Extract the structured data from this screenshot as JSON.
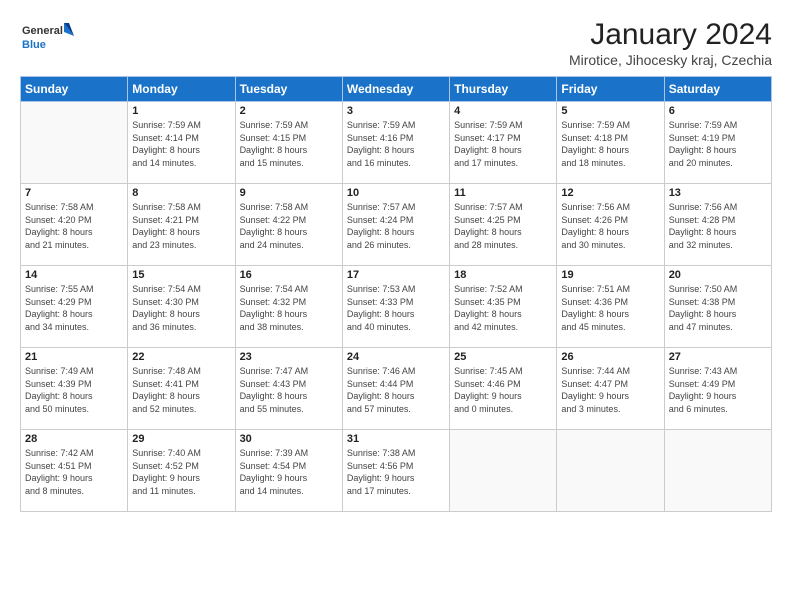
{
  "logo": {
    "line1": "General",
    "line2": "Blue"
  },
  "title": "January 2024",
  "subtitle": "Mirotice, Jihocesky kraj, Czechia",
  "header_days": [
    "Sunday",
    "Monday",
    "Tuesday",
    "Wednesday",
    "Thursday",
    "Friday",
    "Saturday"
  ],
  "weeks": [
    [
      {
        "day": "",
        "info": ""
      },
      {
        "day": "1",
        "info": "Sunrise: 7:59 AM\nSunset: 4:14 PM\nDaylight: 8 hours\nand 14 minutes."
      },
      {
        "day": "2",
        "info": "Sunrise: 7:59 AM\nSunset: 4:15 PM\nDaylight: 8 hours\nand 15 minutes."
      },
      {
        "day": "3",
        "info": "Sunrise: 7:59 AM\nSunset: 4:16 PM\nDaylight: 8 hours\nand 16 minutes."
      },
      {
        "day": "4",
        "info": "Sunrise: 7:59 AM\nSunset: 4:17 PM\nDaylight: 8 hours\nand 17 minutes."
      },
      {
        "day": "5",
        "info": "Sunrise: 7:59 AM\nSunset: 4:18 PM\nDaylight: 8 hours\nand 18 minutes."
      },
      {
        "day": "6",
        "info": "Sunrise: 7:59 AM\nSunset: 4:19 PM\nDaylight: 8 hours\nand 20 minutes."
      }
    ],
    [
      {
        "day": "7",
        "info": "Sunrise: 7:58 AM\nSunset: 4:20 PM\nDaylight: 8 hours\nand 21 minutes."
      },
      {
        "day": "8",
        "info": "Sunrise: 7:58 AM\nSunset: 4:21 PM\nDaylight: 8 hours\nand 23 minutes."
      },
      {
        "day": "9",
        "info": "Sunrise: 7:58 AM\nSunset: 4:22 PM\nDaylight: 8 hours\nand 24 minutes."
      },
      {
        "day": "10",
        "info": "Sunrise: 7:57 AM\nSunset: 4:24 PM\nDaylight: 8 hours\nand 26 minutes."
      },
      {
        "day": "11",
        "info": "Sunrise: 7:57 AM\nSunset: 4:25 PM\nDaylight: 8 hours\nand 28 minutes."
      },
      {
        "day": "12",
        "info": "Sunrise: 7:56 AM\nSunset: 4:26 PM\nDaylight: 8 hours\nand 30 minutes."
      },
      {
        "day": "13",
        "info": "Sunrise: 7:56 AM\nSunset: 4:28 PM\nDaylight: 8 hours\nand 32 minutes."
      }
    ],
    [
      {
        "day": "14",
        "info": "Sunrise: 7:55 AM\nSunset: 4:29 PM\nDaylight: 8 hours\nand 34 minutes."
      },
      {
        "day": "15",
        "info": "Sunrise: 7:54 AM\nSunset: 4:30 PM\nDaylight: 8 hours\nand 36 minutes."
      },
      {
        "day": "16",
        "info": "Sunrise: 7:54 AM\nSunset: 4:32 PM\nDaylight: 8 hours\nand 38 minutes."
      },
      {
        "day": "17",
        "info": "Sunrise: 7:53 AM\nSunset: 4:33 PM\nDaylight: 8 hours\nand 40 minutes."
      },
      {
        "day": "18",
        "info": "Sunrise: 7:52 AM\nSunset: 4:35 PM\nDaylight: 8 hours\nand 42 minutes."
      },
      {
        "day": "19",
        "info": "Sunrise: 7:51 AM\nSunset: 4:36 PM\nDaylight: 8 hours\nand 45 minutes."
      },
      {
        "day": "20",
        "info": "Sunrise: 7:50 AM\nSunset: 4:38 PM\nDaylight: 8 hours\nand 47 minutes."
      }
    ],
    [
      {
        "day": "21",
        "info": "Sunrise: 7:49 AM\nSunset: 4:39 PM\nDaylight: 8 hours\nand 50 minutes."
      },
      {
        "day": "22",
        "info": "Sunrise: 7:48 AM\nSunset: 4:41 PM\nDaylight: 8 hours\nand 52 minutes."
      },
      {
        "day": "23",
        "info": "Sunrise: 7:47 AM\nSunset: 4:43 PM\nDaylight: 8 hours\nand 55 minutes."
      },
      {
        "day": "24",
        "info": "Sunrise: 7:46 AM\nSunset: 4:44 PM\nDaylight: 8 hours\nand 57 minutes."
      },
      {
        "day": "25",
        "info": "Sunrise: 7:45 AM\nSunset: 4:46 PM\nDaylight: 9 hours\nand 0 minutes."
      },
      {
        "day": "26",
        "info": "Sunrise: 7:44 AM\nSunset: 4:47 PM\nDaylight: 9 hours\nand 3 minutes."
      },
      {
        "day": "27",
        "info": "Sunrise: 7:43 AM\nSunset: 4:49 PM\nDaylight: 9 hours\nand 6 minutes."
      }
    ],
    [
      {
        "day": "28",
        "info": "Sunrise: 7:42 AM\nSunset: 4:51 PM\nDaylight: 9 hours\nand 8 minutes."
      },
      {
        "day": "29",
        "info": "Sunrise: 7:40 AM\nSunset: 4:52 PM\nDaylight: 9 hours\nand 11 minutes."
      },
      {
        "day": "30",
        "info": "Sunrise: 7:39 AM\nSunset: 4:54 PM\nDaylight: 9 hours\nand 14 minutes."
      },
      {
        "day": "31",
        "info": "Sunrise: 7:38 AM\nSunset: 4:56 PM\nDaylight: 9 hours\nand 17 minutes."
      },
      {
        "day": "",
        "info": ""
      },
      {
        "day": "",
        "info": ""
      },
      {
        "day": "",
        "info": ""
      }
    ]
  ]
}
